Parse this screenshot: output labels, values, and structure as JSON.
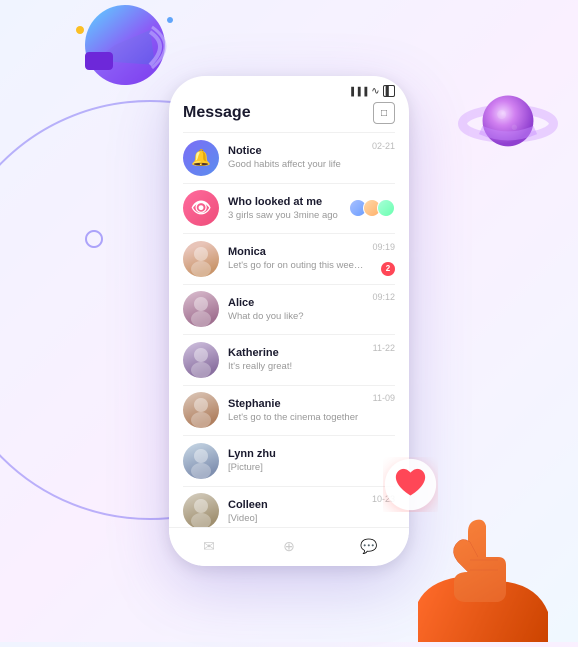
{
  "app": {
    "title": "Message",
    "status": {
      "signal": "▐▐▐▐",
      "wifi": "WiFi",
      "battery": "🔋"
    },
    "header_icon": "✉"
  },
  "messages": [
    {
      "id": "notice",
      "name": "Notice",
      "preview": "Good habits affect your life",
      "time": "02-21",
      "avatar_type": "icon",
      "icon": "🔔",
      "avatar_class": "avatar-notice"
    },
    {
      "id": "who-looked",
      "name": "Who looked at me",
      "preview": "3 girls saw you 3mine ago",
      "time": "",
      "avatar_type": "icon",
      "icon": "👁",
      "avatar_class": "avatar-who"
    },
    {
      "id": "monica",
      "name": "Monica",
      "preview": "Let's go for on outing this weekend-",
      "time": "09:19",
      "avatar_class": "avatar-monica",
      "has_unread": true
    },
    {
      "id": "alice",
      "name": "Alice",
      "preview": "What do you like?",
      "time": "09:12",
      "avatar_class": "avatar-alice"
    },
    {
      "id": "katherine",
      "name": "Katherine",
      "preview": "It's really  great!",
      "time": "11-22",
      "avatar_class": "avatar-katherine"
    },
    {
      "id": "stephanie",
      "name": "Stephanie",
      "preview": "Let's go to the cinema together",
      "time": "11-09",
      "avatar_class": "avatar-stephanie"
    },
    {
      "id": "lynn",
      "name": "Lynn zhu",
      "preview": "[Picture]",
      "time": "",
      "avatar_class": "avatar-lynn"
    },
    {
      "id": "colleen",
      "name": "Colleen",
      "preview": "[Video]",
      "time": "10-23",
      "avatar_class": "avatar-colleen"
    }
  ],
  "tabs": [
    {
      "id": "chat",
      "icon": "💬",
      "active": false
    },
    {
      "id": "discover",
      "icon": "🌐",
      "active": false
    },
    {
      "id": "message",
      "icon": "✉",
      "active": true
    }
  ],
  "decorations": {
    "megaphone_label": "megaphone",
    "planet_label": "planet",
    "hand_label": "hand",
    "heart_label": "heart"
  }
}
